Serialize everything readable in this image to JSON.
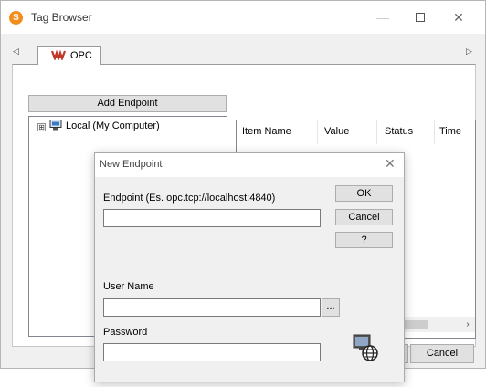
{
  "window": {
    "title": "Tag Browser",
    "app_icon": "S",
    "controls": {
      "minimize": "—",
      "close": "✕"
    }
  },
  "tabs": {
    "scroll_left": "◁",
    "scroll_right": "▷",
    "items": [
      {
        "label": "OPC",
        "icon": "opc-logo-icon"
      }
    ]
  },
  "left": {
    "add_endpoint_label": "Add Endpoint",
    "tree": [
      {
        "label": "Local (My Computer)",
        "expander": "⊞",
        "icon": "computer-icon"
      }
    ]
  },
  "list": {
    "columns": [
      "Item Name",
      "Value",
      "Status",
      "Time"
    ],
    "scroll_right": "›"
  },
  "footer": {
    "cancel_label": "Cancel"
  },
  "dialog": {
    "title": "New Endpoint",
    "close": "✕",
    "endpoint_label": "Endpoint (Es. opc.tcp://localhost:4840)",
    "endpoint_value": "",
    "ok_label": "OK",
    "cancel_label": "Cancel",
    "help_label": "?",
    "username_label": "User Name",
    "username_value": "",
    "browse_label": "...",
    "password_label": "Password",
    "password_value": "",
    "network_icon": "network-computer-icon"
  },
  "colors": {
    "accent": "#f28c1b",
    "opc_logo": "#c0392b"
  }
}
